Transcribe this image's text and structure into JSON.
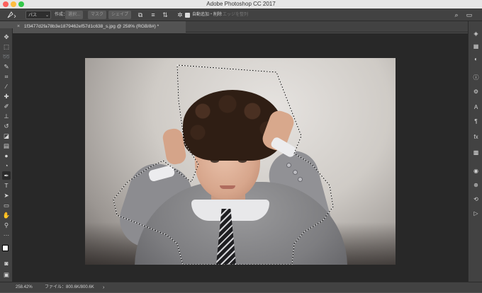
{
  "window": {
    "title": "Adobe Photoshop CC 2017"
  },
  "options_bar": {
    "mode_value": "パス",
    "create_label": "作成：",
    "selection_button": "選択...",
    "mask_button": "マスク",
    "shape_button": "シェイプ",
    "auto_add_delete_label": "自動追加・削除",
    "align_edges_label": "エッジを整列",
    "auto_add_delete_checked": true
  },
  "document": {
    "tab_title": "1f3477d2fa78b3e1879462ef57d1c638_s.jpg @ 258% (RGB/8#) *",
    "close_glyph": "×"
  },
  "status": {
    "zoom": "258.42%",
    "file_info": "ファイル：800.6K/800.6K",
    "arrow": "›"
  },
  "tools": [
    "move-tool",
    "marquee-tool",
    "lasso-tool",
    "quick-select-tool",
    "crop-tool",
    "eyedropper-tool",
    "healing-tool",
    "brush-tool",
    "stamp-tool",
    "history-brush-tool",
    "eraser-tool",
    "gradient-tool",
    "blur-tool",
    "dodge-tool",
    "pen-tool",
    "type-tool",
    "path-select-tool",
    "rectangle-tool",
    "hand-tool",
    "zoom-tool",
    "more-tools"
  ],
  "dock_panels": [
    "layers-icon",
    "channels-icon",
    "adjustments-icon",
    "info-icon",
    "properties-icon",
    "character-icon",
    "paragraph-icon",
    "styles-icon",
    "swatches-icon",
    "color-icon",
    "navigator-icon",
    "history-icon",
    "actions-icon"
  ]
}
